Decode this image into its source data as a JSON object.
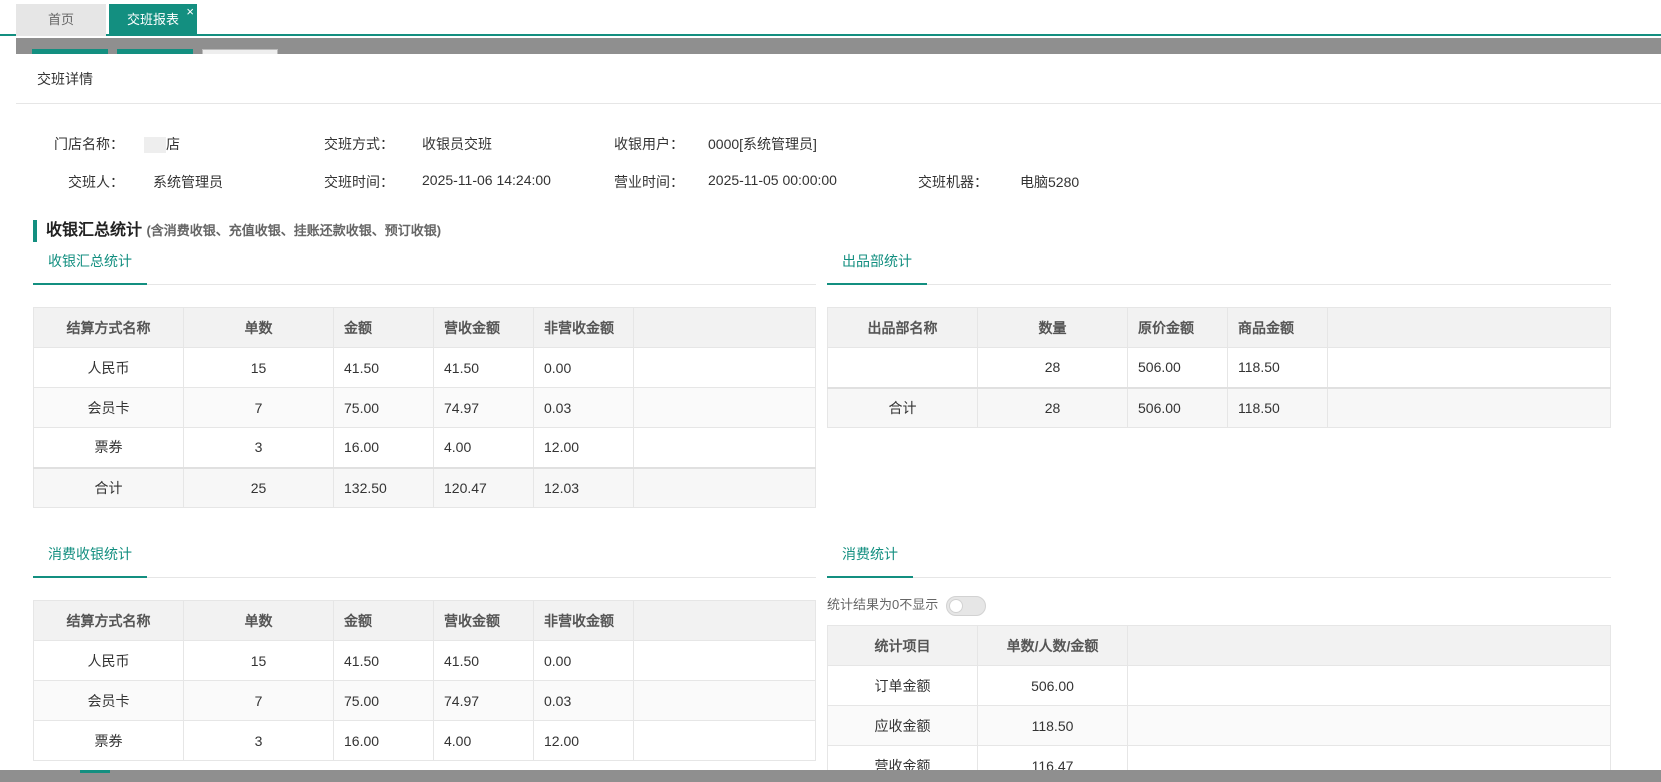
{
  "tabs": {
    "home": "首页",
    "report": "交班报表",
    "close": "×"
  },
  "panel_title": "交班详情",
  "info": {
    "store_label": "门店名称：",
    "store_value": "店",
    "method_label": "交班方式：",
    "method_value": "收银员交班",
    "user_label": "收银用户：",
    "user_value": "0000[系统管理员]",
    "shifter_label": "交班人：",
    "shifter_value": "系统管理员",
    "shift_time_label": "交班时间：",
    "shift_time_value": "2025-11-06 14:24:00",
    "biz_time_label": "营业时间：",
    "biz_time_value": "2025-11-05 00:00:00",
    "machine_label": "交班机器：",
    "machine_value": "电脑5280"
  },
  "section": {
    "title": "收银汇总统计",
    "subtitle": "(含消费收银、充值收银、挂账还款收银、预订收银)"
  },
  "cash_summary": {
    "tab": "收银汇总统计",
    "headers": [
      "结算方式名称",
      "单数",
      "金额",
      "营收金额",
      "非营收金额"
    ],
    "rows": [
      [
        "人民币",
        "15",
        "41.50",
        "41.50",
        "0.00"
      ],
      [
        "会员卡",
        "7",
        "75.00",
        "74.97",
        "0.03"
      ],
      [
        "票券",
        "3",
        "16.00",
        "4.00",
        "12.00"
      ]
    ],
    "total": [
      "合计",
      "25",
      "132.50",
      "120.47",
      "12.03"
    ]
  },
  "dept_stats": {
    "tab": "出品部统计",
    "headers": [
      "出品部名称",
      "数量",
      "原价金额",
      "商品金额"
    ],
    "rows": [
      [
        "",
        "28",
        "506.00",
        "118.50"
      ]
    ],
    "total": [
      "合计",
      "28",
      "506.00",
      "118.50"
    ]
  },
  "consume_cash": {
    "tab": "消费收银统计",
    "headers": [
      "结算方式名称",
      "单数",
      "金额",
      "营收金额",
      "非营收金额"
    ],
    "rows": [
      [
        "人民币",
        "15",
        "41.50",
        "41.50",
        "0.00"
      ],
      [
        "会员卡",
        "7",
        "75.00",
        "74.97",
        "0.03"
      ],
      [
        "票券",
        "3",
        "16.00",
        "4.00",
        "12.00"
      ]
    ]
  },
  "consume_stats": {
    "tab": "消费统计",
    "toggle_label": "统计结果为0不显示",
    "toggle_on": false,
    "headers": [
      "统计项目",
      "单数/人数/金额"
    ],
    "rows": [
      [
        "订单金额",
        "506.00"
      ],
      [
        "应收金额",
        "118.50"
      ],
      [
        "营收金额",
        "116.47"
      ]
    ]
  },
  "colors": {
    "accent": "#138f80"
  }
}
